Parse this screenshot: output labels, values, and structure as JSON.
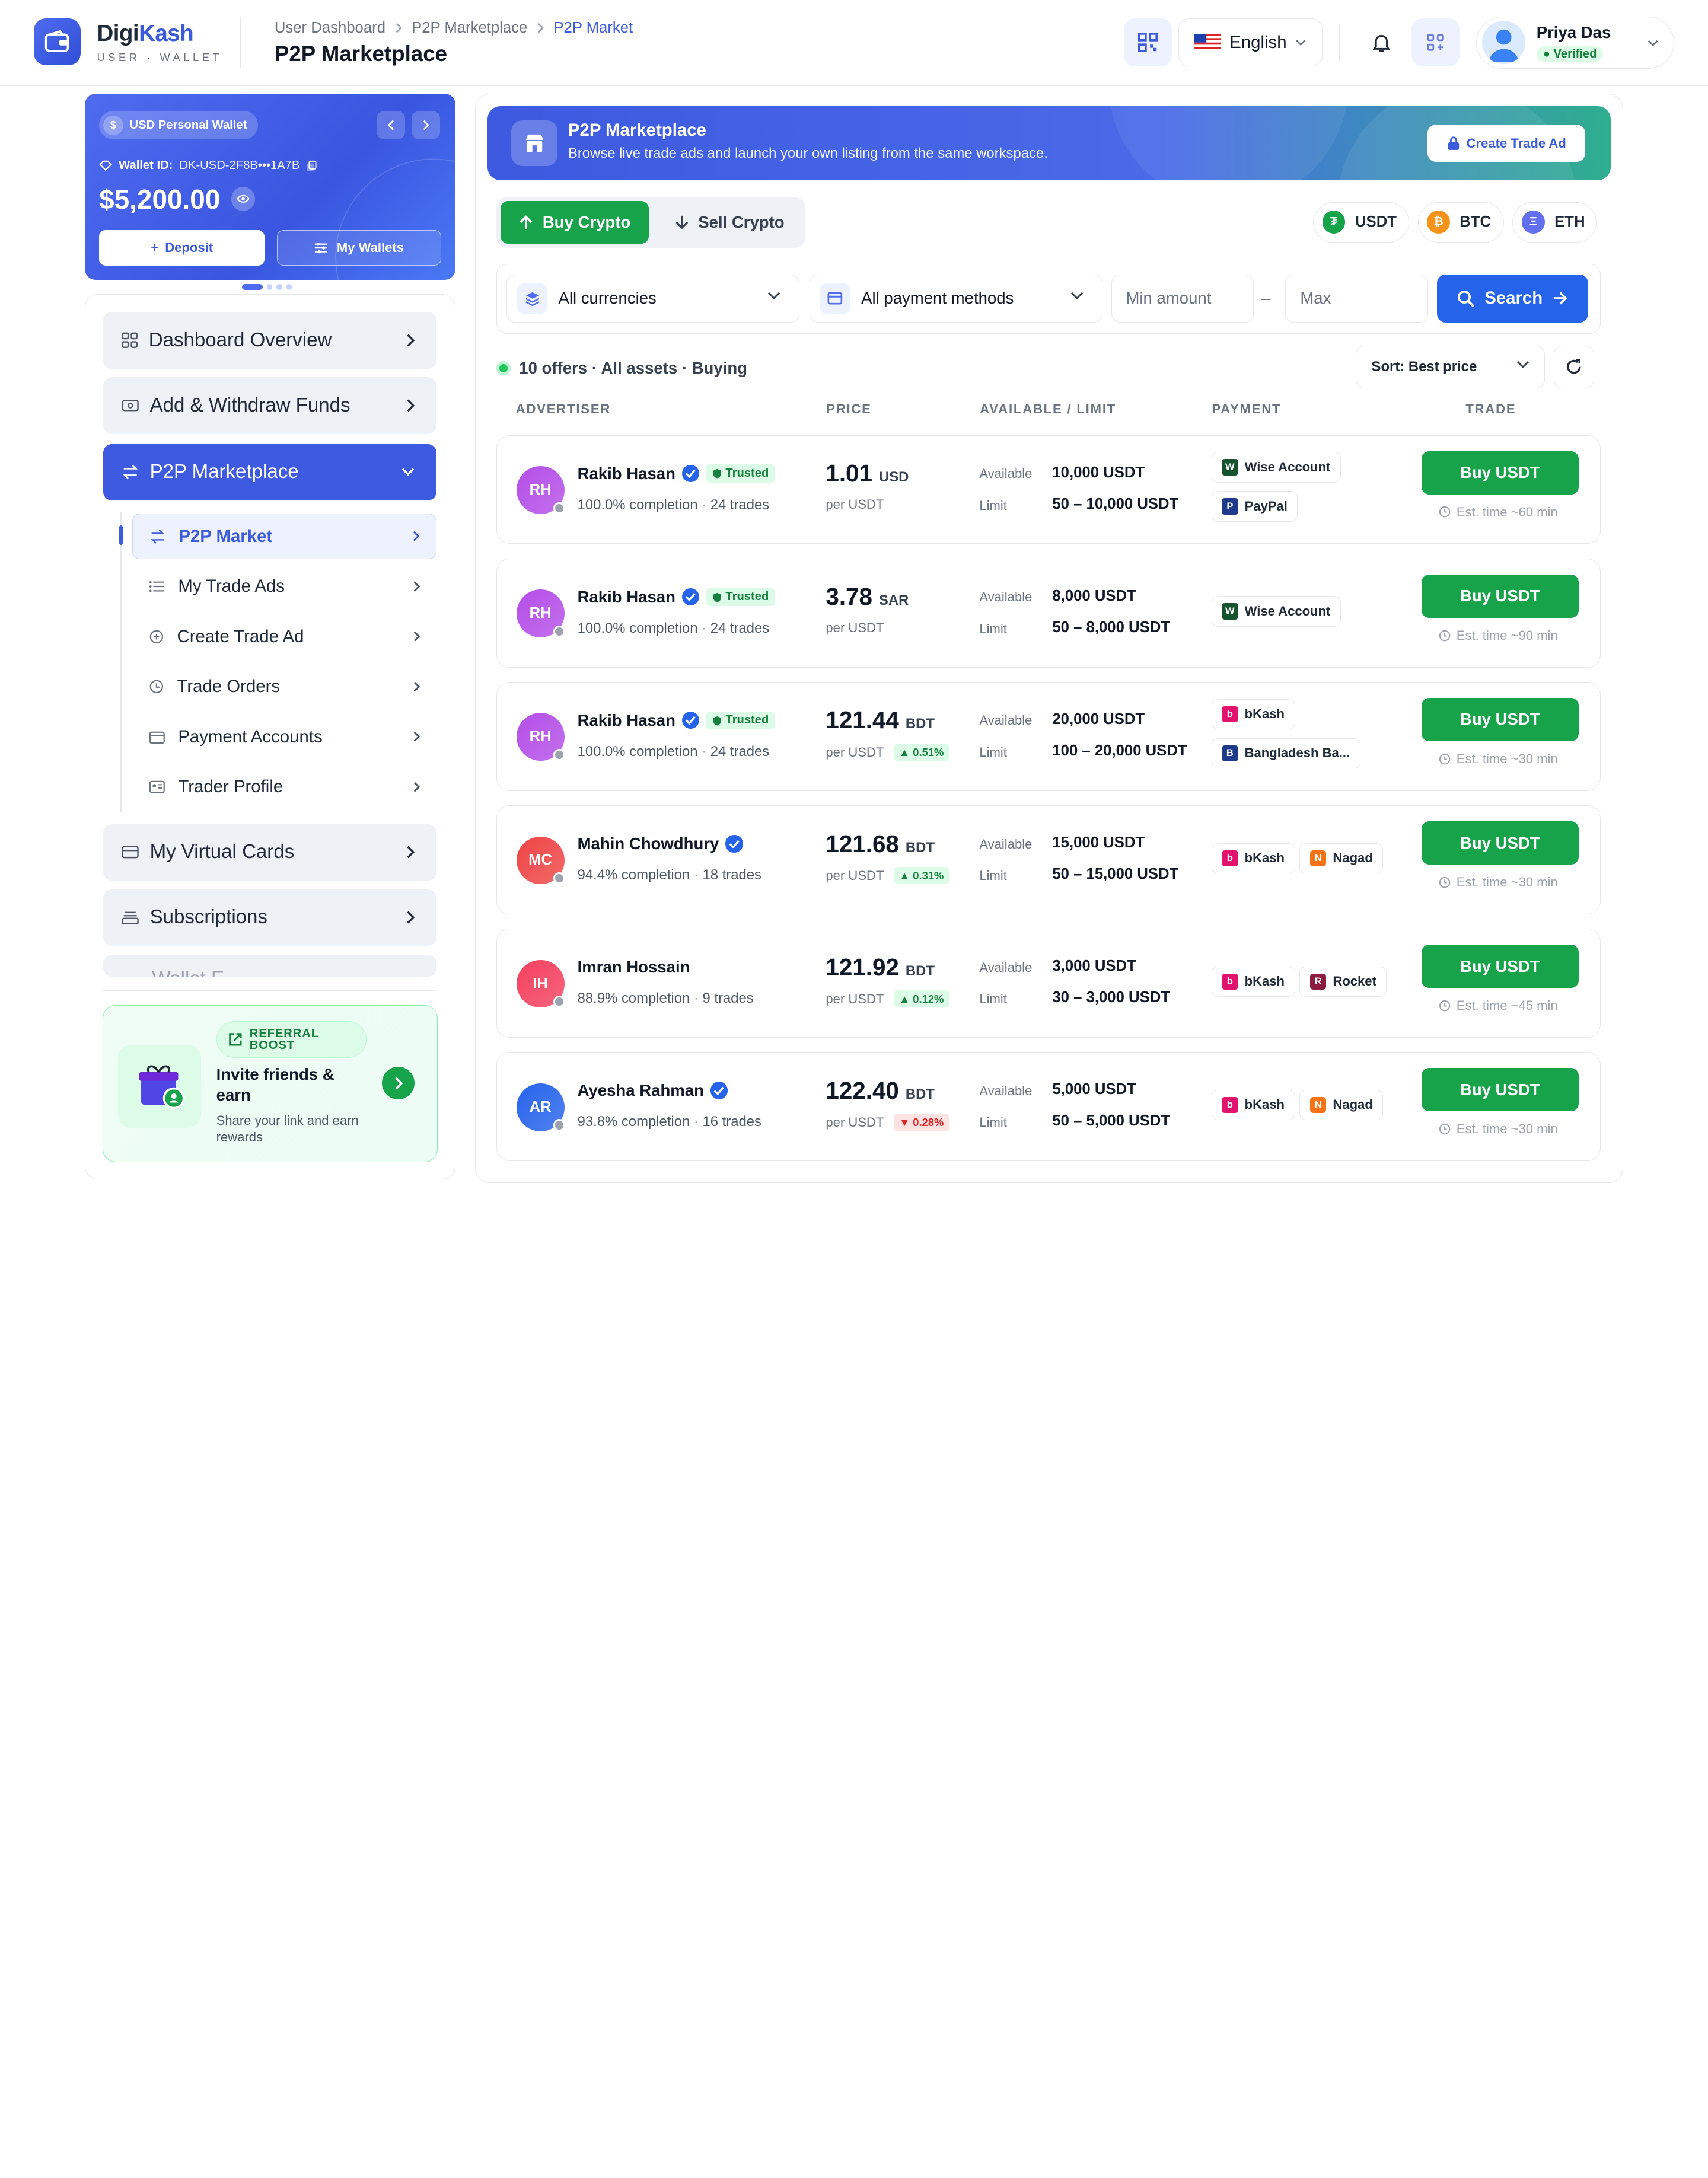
{
  "brand": {
    "name_a": "Digi",
    "name_b": "Kash",
    "tagline": "USER · WALLET"
  },
  "breadcrumb": [
    "User Dashboard",
    "P2P Marketplace",
    "P2P Market"
  ],
  "page_title": "P2P Marketplace",
  "header": {
    "language": "English",
    "user_name": "Priya Das",
    "user_status": "Verified"
  },
  "wallet": {
    "label": "USD Personal Wallet",
    "id_label": "Wallet ID:",
    "id_value": "DK-USD-2F8B•••1A7B",
    "balance": "$5,200.00",
    "deposit": "Deposit",
    "my_wallets": "My Wallets"
  },
  "sidebar": {
    "items": [
      {
        "label": "Dashboard Overview",
        "icon": "grid-icon"
      },
      {
        "label": "Add & Withdraw Funds",
        "icon": "cash-icon"
      },
      {
        "label": "P2P Marketplace",
        "icon": "swap-icon"
      },
      {
        "label": "My Virtual Cards",
        "icon": "card-icon"
      },
      {
        "label": "Subscriptions",
        "icon": "layers-icon"
      },
      {
        "label": "Wallet E..."
      }
    ],
    "sub_items": [
      "P2P Market",
      "My Trade Ads",
      "Create Trade Ad",
      "Trade Orders",
      "Payment Accounts",
      "Trader Profile"
    ]
  },
  "referral": {
    "tag": "REFERRAL BOOST",
    "title": "Invite friends & earn",
    "subtitle": "Share your link and earn rewards"
  },
  "banner": {
    "title": "P2P Marketplace",
    "subtitle": "Browse live trade ads and launch your own listing from the same workspace.",
    "button": "Create Trade Ad"
  },
  "tabs": {
    "buy": "Buy Crypto",
    "sell": "Sell Crypto"
  },
  "coins": [
    {
      "name": "USDT",
      "color": "#16a34a",
      "glyph": "₮"
    },
    {
      "name": "BTC",
      "color": "#f7931a",
      "glyph": "₿"
    },
    {
      "name": "ETH",
      "color": "#6270f0",
      "glyph": "Ξ"
    }
  ],
  "filters": {
    "currency": "All currencies",
    "payment": "All payment methods",
    "min_placeholder": "Min amount",
    "dash": "–",
    "max_placeholder": "Max",
    "search": "Search"
  },
  "results": {
    "count": "10 offers · All assets · Buying",
    "sort": "Sort: Best price"
  },
  "columns": [
    "ADVERTISER",
    "PRICE",
    "AVAILABLE / LIMIT",
    "PAYMENT",
    "TRADE"
  ],
  "labels": {
    "available": "Available",
    "limit": "Limit",
    "trusted": "Trusted"
  },
  "offers": [
    {
      "initials": "RH",
      "name": "Rakib Hasan",
      "verified": true,
      "trusted": true,
      "completion": "100.0% completion",
      "trades": "24 trades",
      "price": "1.01",
      "currency": "USD",
      "unit": "per USDT",
      "change": "",
      "change_dir": "",
      "available": "10,000 USDT",
      "limit": "50 – 10,000 USDT",
      "payments": [
        {
          "name": "Wise Account",
          "icon": "wise-icon",
          "color": "#14532d",
          "glyph": "W"
        },
        {
          "name": "PayPal",
          "icon": "paypal-icon",
          "color": "#1e3a8a",
          "glyph": "P"
        }
      ],
      "button": "Buy USDT",
      "eta": "Est. time ~60 min",
      "avatar": "#b44de8"
    },
    {
      "initials": "RH",
      "name": "Rakib Hasan",
      "verified": true,
      "trusted": true,
      "completion": "100.0% completion",
      "trades": "24 trades",
      "price": "3.78",
      "currency": "SAR",
      "unit": "per USDT",
      "change": "",
      "change_dir": "",
      "available": "8,000 USDT",
      "limit": "50 – 8,000 USDT",
      "payments": [
        {
          "name": "Wise Account",
          "icon": "wise-icon",
          "color": "#14532d",
          "glyph": "W"
        }
      ],
      "button": "Buy USDT",
      "eta": "Est. time ~90 min",
      "avatar": "#b44de8"
    },
    {
      "initials": "RH",
      "name": "Rakib Hasan",
      "verified": true,
      "trusted": true,
      "completion": "100.0% completion",
      "trades": "24 trades",
      "price": "121.44",
      "currency": "BDT",
      "unit": "per USDT",
      "change": "0.51%",
      "change_dir": "up",
      "available": "20,000 USDT",
      "limit": "100 – 20,000 USDT",
      "payments": [
        {
          "name": "bKash",
          "icon": "bkash-icon",
          "color": "#e2136e",
          "glyph": "b"
        },
        {
          "name": "Bangladesh Ba...",
          "icon": "bank-icon",
          "color": "#1e3a8a",
          "glyph": "B"
        }
      ],
      "button": "Buy USDT",
      "eta": "Est. time ~30 min",
      "avatar": "#b44de8"
    },
    {
      "initials": "MC",
      "name": "Mahin Chowdhury",
      "verified": true,
      "trusted": false,
      "completion": "94.4% completion",
      "trades": "18 trades",
      "price": "121.68",
      "currency": "BDT",
      "unit": "per USDT",
      "change": "0.31%",
      "change_dir": "up",
      "available": "15,000 USDT",
      "limit": "50 – 15,000 USDT",
      "payments": [
        {
          "name": "bKash",
          "icon": "bkash-icon",
          "color": "#e2136e",
          "glyph": "b"
        },
        {
          "name": "Nagad",
          "icon": "nagad-icon",
          "color": "#f97316",
          "glyph": "N"
        }
      ],
      "button": "Buy USDT",
      "eta": "Est. time ~30 min",
      "avatar": "#ef4444"
    },
    {
      "initials": "IH",
      "name": "Imran Hossain",
      "verified": false,
      "trusted": false,
      "completion": "88.9% completion",
      "trades": "9 trades",
      "price": "121.92",
      "currency": "BDT",
      "unit": "per USDT",
      "change": "0.12%",
      "change_dir": "up",
      "available": "3,000 USDT",
      "limit": "30 – 3,000 USDT",
      "payments": [
        {
          "name": "bKash",
          "icon": "bkash-icon",
          "color": "#e2136e",
          "glyph": "b"
        },
        {
          "name": "Rocket",
          "icon": "rocket-icon",
          "color": "#8c1d40",
          "glyph": "R"
        }
      ],
      "button": "Buy USDT",
      "eta": "Est. time ~45 min",
      "avatar": "#f43f5e"
    },
    {
      "initials": "AR",
      "name": "Ayesha Rahman",
      "verified": true,
      "trusted": false,
      "completion": "93.8% completion",
      "trades": "16 trades",
      "price": "122.40",
      "currency": "BDT",
      "unit": "per USDT",
      "change": "0.28%",
      "change_dir": "down",
      "available": "5,000 USDT",
      "limit": "50 – 5,000 USDT",
      "payments": [
        {
          "name": "bKash",
          "icon": "bkash-icon",
          "color": "#e2136e",
          "glyph": "b"
        },
        {
          "name": "Nagad",
          "icon": "nagad-icon",
          "color": "#f97316",
          "glyph": "N"
        }
      ],
      "button": "Buy USDT",
      "eta": "Est. time ~30 min",
      "avatar": "#2563eb"
    }
  ]
}
